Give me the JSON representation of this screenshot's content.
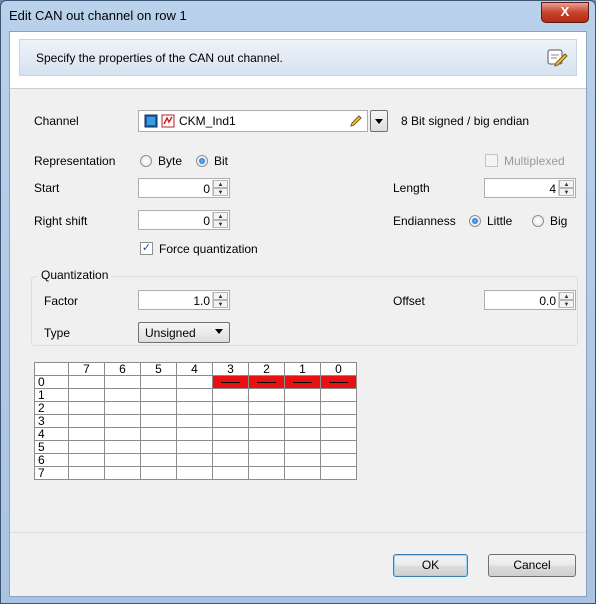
{
  "window": {
    "title": "Edit CAN out channel on row 1",
    "close_label": "X"
  },
  "header": {
    "text": "Specify the properties of the CAN out channel.",
    "icon": "edit-properties-icon"
  },
  "channel": {
    "label": "Channel",
    "value": "CKM_Ind1",
    "info": "8 Bit signed / big endian"
  },
  "representation": {
    "label": "Representation",
    "options": [
      "Byte",
      "Bit"
    ],
    "selected": "Bit"
  },
  "multiplexed": {
    "label": "Multiplexed",
    "checked": false,
    "enabled": false
  },
  "start": {
    "label": "Start",
    "value": "0"
  },
  "length": {
    "label": "Length",
    "value": "4"
  },
  "right_shift": {
    "label": "Right shift",
    "value": "0"
  },
  "endianness": {
    "label": "Endianness",
    "options": [
      "Little",
      "Big"
    ],
    "selected": "Little"
  },
  "force_quantization": {
    "label": "Force quantization",
    "checked": true
  },
  "quantization": {
    "title": "Quantization",
    "factor_label": "Factor",
    "factor_value": "1.0",
    "offset_label": "Offset",
    "offset_value": "0.0",
    "type_label": "Type",
    "type_value": "Unsigned"
  },
  "bit_grid": {
    "columns": [
      "7",
      "6",
      "5",
      "4",
      "3",
      "2",
      "1",
      "0"
    ],
    "rows": [
      "0",
      "1",
      "2",
      "3",
      "4",
      "5",
      "6",
      "7"
    ],
    "highlight_color": "#e81010",
    "highlighted": [
      {
        "row": 0,
        "bits": [
          3,
          2,
          1,
          0
        ]
      }
    ]
  },
  "buttons": {
    "ok": "OK",
    "cancel": "Cancel"
  }
}
